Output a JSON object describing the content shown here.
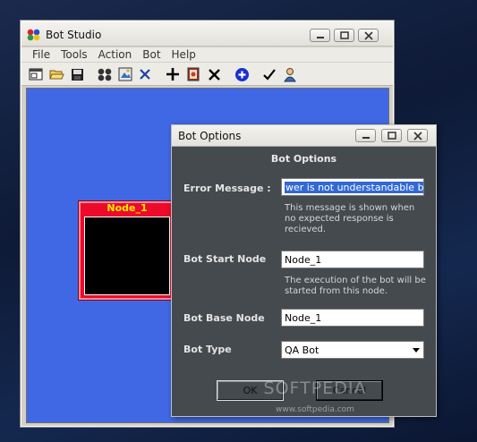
{
  "main_window": {
    "title": "Bot Studio",
    "menu": [
      "File",
      "Tools",
      "Action",
      "Bot",
      "Help"
    ],
    "toolbar_icons": [
      "open-window-icon",
      "open-folder-icon",
      "save-icon",
      "bot-icon",
      "image-icon",
      "cross-icon",
      "add-icon",
      "picture-icon",
      "delete-icon",
      "add-circle-icon",
      "check-icon",
      "user-icon"
    ]
  },
  "node": {
    "title": "Node_1"
  },
  "dialog": {
    "title": "Bot Options",
    "header": "Bot Options",
    "error_message": {
      "label": "Error Message :",
      "value": "wer is not understandable by me.",
      "hint": "This message is shown when no expected response is recieved."
    },
    "bot_start_node": {
      "label": "Bot Start Node",
      "value": "Node_1",
      "hint": "The execution of the bot will be started from this node."
    },
    "bot_base_node": {
      "label": "Bot Base Node",
      "value": "Node_1"
    },
    "bot_type": {
      "label": "Bot Type",
      "value": "QA Bot"
    },
    "ok_label": "OK",
    "cancel_label": "Cancel"
  },
  "watermark": {
    "text": "SOFTPEDIA",
    "url": "www.softpedia.com"
  },
  "colors": {
    "canvas": "#4168e4",
    "node_red": "#ee0a2a",
    "node_title": "#ffee00",
    "dialog_bg": "#444a4e",
    "selection": "#3268d4"
  }
}
